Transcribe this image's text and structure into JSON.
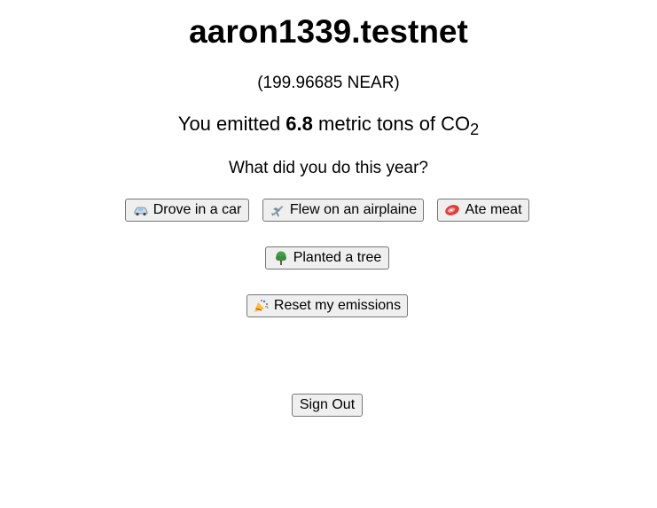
{
  "header": {
    "account_name": "aaron1339.testnet",
    "balance": "(199.96685 NEAR)"
  },
  "emissions": {
    "prefix": "You emitted ",
    "amount": "6.8",
    "middle": " metric tons of CO",
    "subscript": "2"
  },
  "question": "What did you do this year?",
  "actions": {
    "car": {
      "label": "Drove in a car",
      "icon": "car-icon"
    },
    "airplane": {
      "label": "Flew on an airplaine",
      "icon": "airplane-icon"
    },
    "meat": {
      "label": "Ate meat",
      "icon": "meat-icon"
    },
    "tree": {
      "label": "Planted a tree",
      "icon": "tree-icon"
    },
    "reset": {
      "label": "Reset my emissions",
      "icon": "party-popper-icon"
    }
  },
  "sign_out_label": "Sign Out"
}
